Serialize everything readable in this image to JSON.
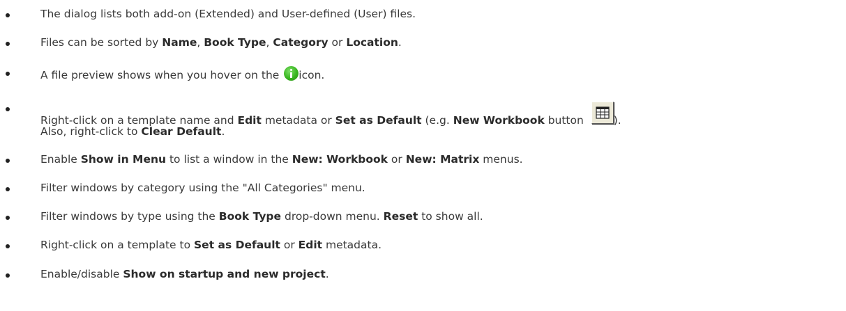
{
  "items": [
    {
      "parts": [
        "The dialog lists both add-on (Extended) and User-defined (User) files."
      ]
    },
    {
      "parts": [
        "Files can be sorted by ",
        "Name",
        ", ",
        "Book Type",
        ", ",
        "Category",
        " or ",
        "Location",
        "."
      ]
    },
    {
      "parts": [
        "A file preview shows when you hover on the ",
        "icon."
      ],
      "icon": "info-icon"
    },
    {
      "parts": [
        "Right-click on a template name and ",
        "Edit",
        " metadata or ",
        "Set as Default",
        " (e.g. ",
        "New Workbook",
        " button ",
        ")."
      ],
      "icon": "new-workbook-button-icon",
      "line2": [
        "Also, right-click to ",
        "Clear Default",
        "."
      ]
    },
    {
      "parts": [
        "Enable ",
        "Show in Menu",
        " to list a window in the ",
        "New: Workbook",
        " or ",
        "New: Matrix",
        " menus."
      ]
    },
    {
      "parts": [
        "Filter windows by category using the \"All Categories\" menu."
      ]
    },
    {
      "parts": [
        "Filter windows by type using the ",
        "Book Type",
        " drop-down menu. ",
        "Reset",
        " to show all."
      ]
    },
    {
      "parts": [
        "Right-click on a template to ",
        "Set as Default",
        " or ",
        "Edit",
        " metadata."
      ]
    },
    {
      "parts": [
        "Enable/disable ",
        "Show on startup and new project",
        "."
      ]
    }
  ]
}
